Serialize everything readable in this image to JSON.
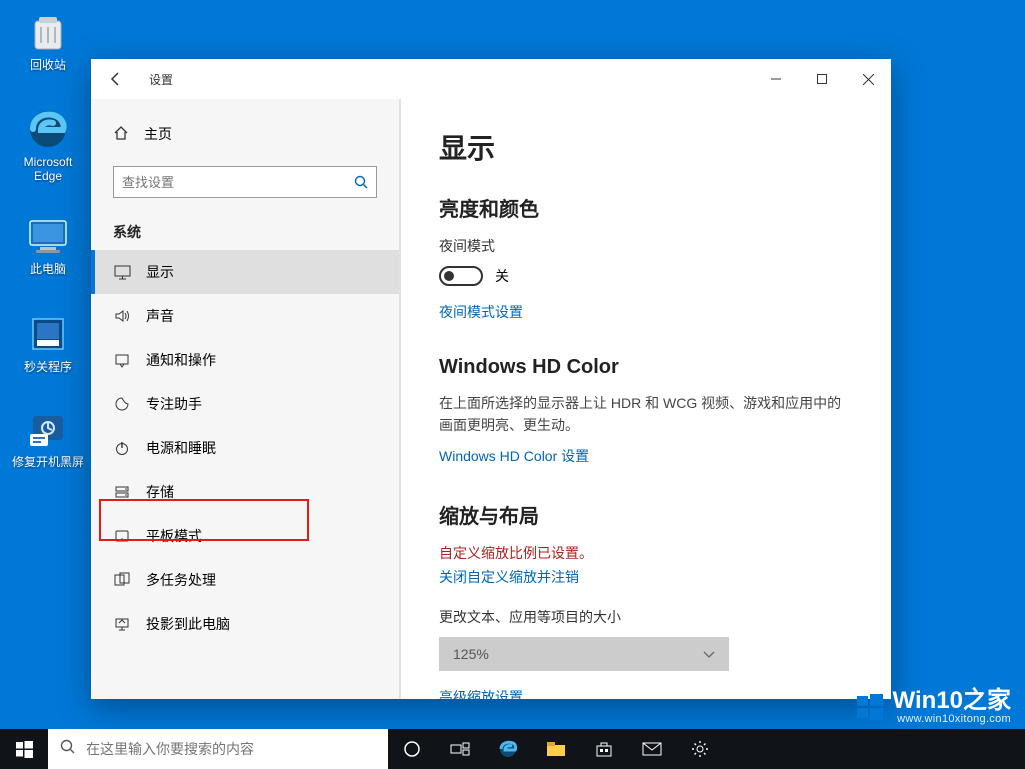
{
  "desktop": {
    "icons": [
      {
        "name": "回收站"
      },
      {
        "name": "Microsoft Edge"
      },
      {
        "name": "此电脑"
      },
      {
        "name": "秒关程序"
      },
      {
        "name": "修复开机黑屏"
      }
    ]
  },
  "window": {
    "title": "设置",
    "home_label": "主页",
    "search_placeholder": "查找设置",
    "category": "系统",
    "nav": [
      {
        "icon": "display",
        "label": "显示",
        "active": true
      },
      {
        "icon": "sound",
        "label": "声音"
      },
      {
        "icon": "notify",
        "label": "通知和操作"
      },
      {
        "icon": "focus",
        "label": "专注助手"
      },
      {
        "icon": "power",
        "label": "电源和睡眠",
        "highlight": true
      },
      {
        "icon": "storage",
        "label": "存储"
      },
      {
        "icon": "tablet",
        "label": "平板模式"
      },
      {
        "icon": "multi",
        "label": "多任务处理"
      },
      {
        "icon": "project",
        "label": "投影到此电脑"
      }
    ]
  },
  "content": {
    "title": "显示",
    "brightness": {
      "heading": "亮度和颜色",
      "night_label": "夜间模式",
      "toggle_state": "关",
      "night_link": "夜间模式设置"
    },
    "hdcolor": {
      "heading": "Windows HD Color",
      "desc": "在上面所选择的显示器上让 HDR 和 WCG 视频、游戏和应用中的画面更明亮、更生动。",
      "link": "Windows HD Color 设置"
    },
    "scaling": {
      "heading": "缩放与布局",
      "warn": "自定义缩放比例已设置。",
      "reset_link": "关闭自定义缩放并注销",
      "size_label": "更改文本、应用等项目的大小",
      "dropdown_value": "125%",
      "adv_link": "高级缩放设置"
    }
  },
  "taskbar": {
    "search_placeholder": "在这里输入你要搜索的内容"
  },
  "watermark": {
    "title": "Win10之家",
    "sub": "www.win10xitong.com"
  }
}
